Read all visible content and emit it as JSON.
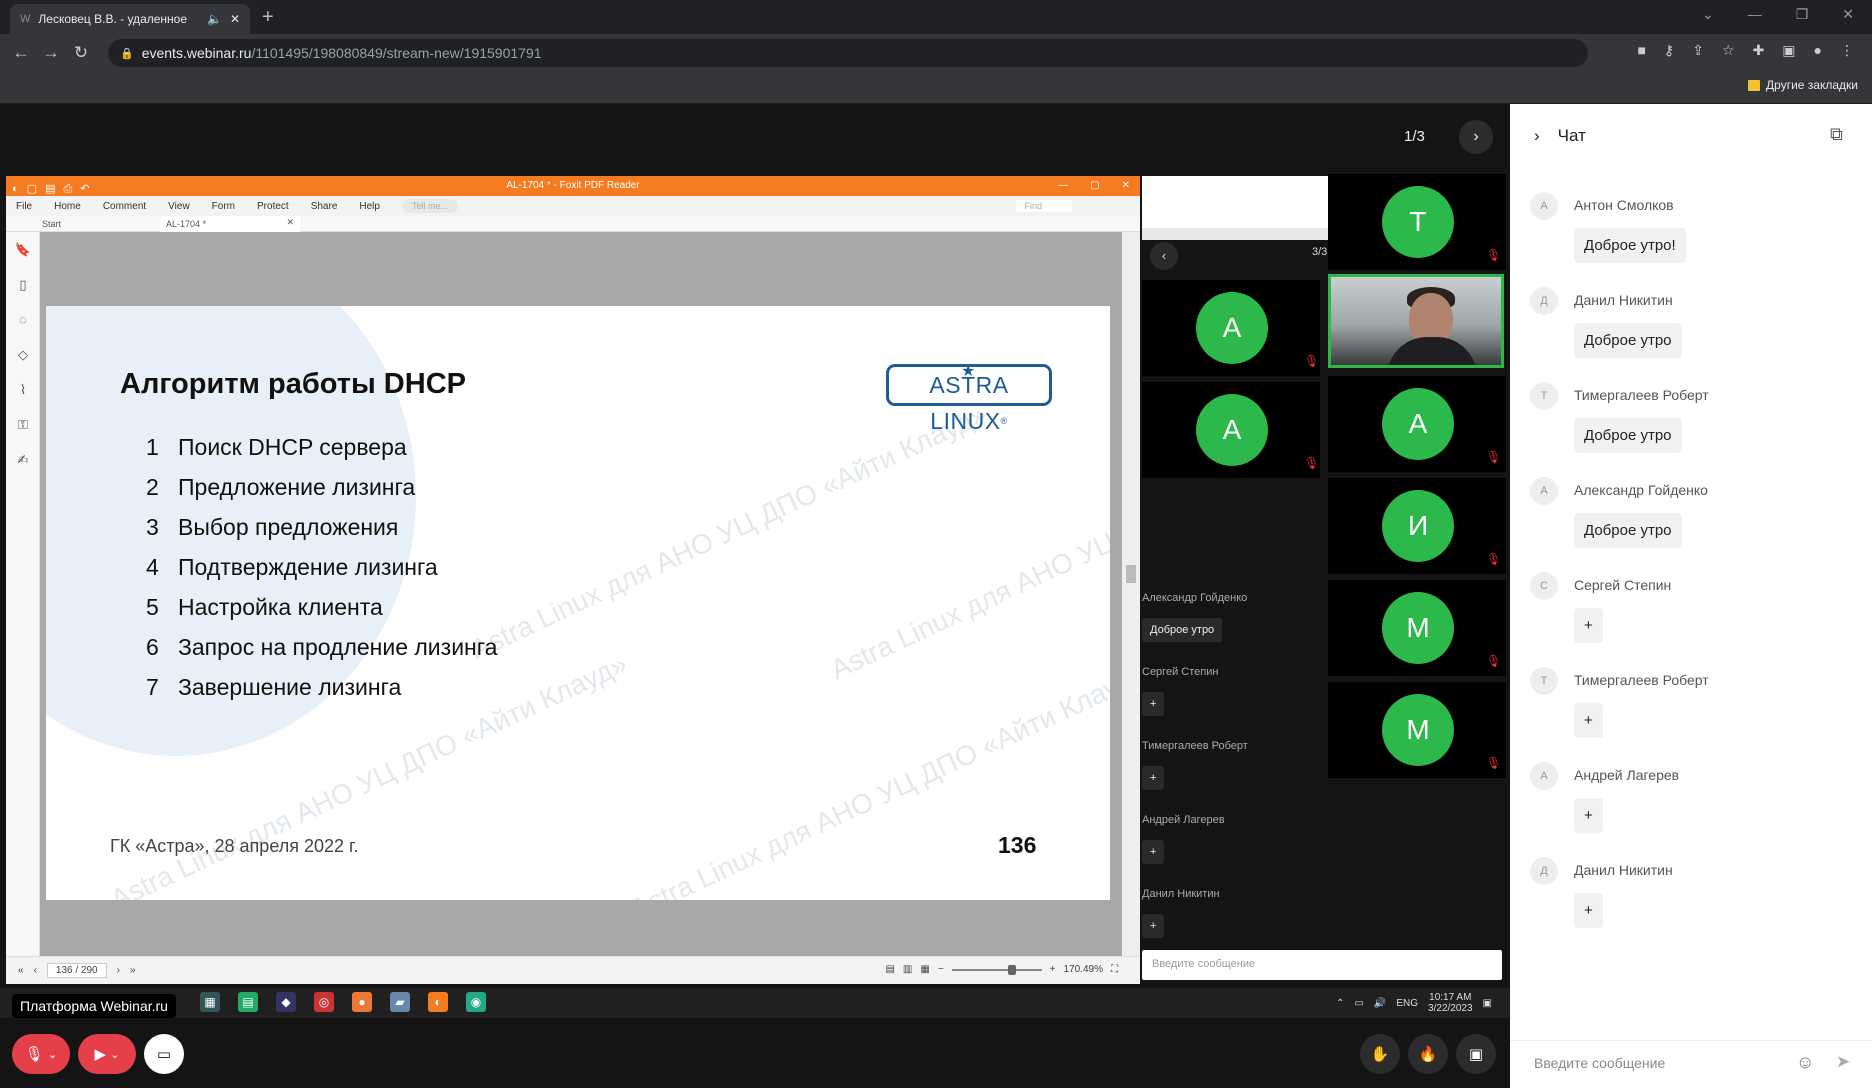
{
  "browser": {
    "tab_title": "Лесковец В.В. - удаленное",
    "url_host": "events.webinar.ru",
    "url_path": "/1101495/198080849/stream-new/1915901791",
    "bookmarks_label": "Другие закладки"
  },
  "stage": {
    "pager": "1/3",
    "platform_label": "Платформа Webinar.ru"
  },
  "foxit": {
    "title": "AL-1704 * - Foxit PDF Reader",
    "menu": [
      "File",
      "Home",
      "Comment",
      "View",
      "Form",
      "Protect",
      "Share",
      "Help"
    ],
    "tell_me": "Tell me...",
    "find": "Find",
    "tab_start": "Start",
    "tab_doc": "AL-1704 *",
    "page_indicator": "136 / 290",
    "zoom": "170.49%"
  },
  "slide": {
    "title": "Алгоритм работы DHCP",
    "logo": "ASTRA LINUX",
    "items": [
      {
        "n": "1",
        "text": "Поиск DHCP сервера"
      },
      {
        "n": "2",
        "text": "Предложение лизинга"
      },
      {
        "n": "3",
        "text": "Выбор предложения"
      },
      {
        "n": "4",
        "text": "Подтверждение лизинга"
      },
      {
        "n": "5",
        "text": "Настройка клиента"
      },
      {
        "n": "6",
        "text": "Запрос на продление лизинга"
      },
      {
        "n": "7",
        "text": "Завершение лизинга"
      }
    ],
    "footer": "ГК «Астра», 28 апреля 2022 г.",
    "page_number": "136",
    "watermark": "Astra Linux для АНО УЦ ДПО «Айти Клауд»"
  },
  "mirror": {
    "page": "3/3",
    "chat": [
      {
        "name": "Александр Гойденко",
        "text": "Доброе утро"
      },
      {
        "name": "Сергей Степин",
        "text": "+"
      },
      {
        "name": "Тимергалеев Роберт",
        "text": "+"
      },
      {
        "name": "Андрей Лагерев",
        "text": "+"
      },
      {
        "name": "Данил Никитин",
        "text": "+"
      }
    ],
    "input_placeholder": "Введите сообщение",
    "avatars": [
      "А",
      "А"
    ]
  },
  "windows_tray": {
    "lang": "ENG",
    "time": "10:17 AM",
    "date": "3/22/2023"
  },
  "videos": [
    "Т",
    "А",
    "И",
    "М",
    "М"
  ],
  "chat": {
    "title": "Чат",
    "messages": [
      {
        "initial": "А",
        "name": "Антон Смолков",
        "text": "Доброе утро!"
      },
      {
        "initial": "Д",
        "name": "Данил Никитин",
        "text": "Доброе утро"
      },
      {
        "initial": "Т",
        "name": "Тимергалеев Роберт",
        "text": "Доброе утро"
      },
      {
        "initial": "А",
        "name": "Александр Гойденко",
        "text": "Доброе утро"
      },
      {
        "initial": "С",
        "name": "Сергей Степин",
        "text": "+"
      },
      {
        "initial": "Т",
        "name": "Тимергалеев Роберт",
        "text": "+"
      },
      {
        "initial": "А",
        "name": "Андрей Лагерев",
        "text": "+"
      },
      {
        "initial": "Д",
        "name": "Данил Никитин",
        "text": "+"
      }
    ],
    "input_placeholder": "Введите сообщение"
  },
  "colors": {
    "foxit_orange": "#f47b20",
    "avatar_green": "#2db84b",
    "astra_blue": "#1f5b94",
    "control_red": "#e5404a"
  }
}
